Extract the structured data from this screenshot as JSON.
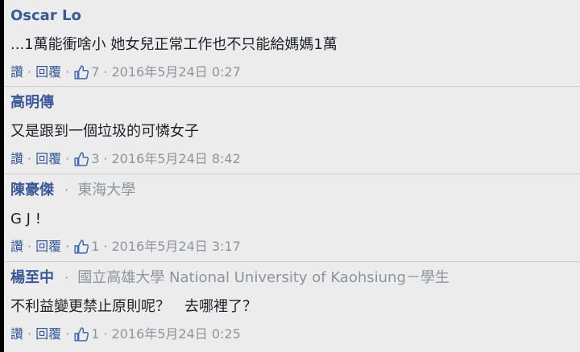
{
  "colors": {
    "author": "#3b5998",
    "link": "#365899",
    "meta": "#8d949e",
    "text": "#1d2129",
    "background": "#ececec",
    "like_icon": "#4267b2"
  },
  "labels": {
    "read": "讚",
    "reply": "回覆",
    "separator": "·",
    "like_icon": "thumbs-up-icon"
  },
  "comments": [
    {
      "author": "Oscar Lo",
      "affiliation": "",
      "text": "...1萬能衝啥小 她女兒正常工作也不只能給媽媽1萬",
      "likes": "7",
      "timestamp": "2016年5月24日 0:27"
    },
    {
      "author": "高明傳",
      "affiliation": "",
      "text": "又是跟到一個垃圾的可憐女子",
      "likes": "3",
      "timestamp": "2016年5月24日 8:42"
    },
    {
      "author": "陳豪傑",
      "affiliation": "東海大學",
      "text": "G J !",
      "likes": "1",
      "timestamp": "2016年5月24日 3:17"
    },
    {
      "author": "楊至中",
      "affiliation": "國立高雄大學 National University of Kaohsiung－學生",
      "text": "不利益變更禁止原則呢？　去哪裡了？",
      "likes": "1",
      "timestamp": "2016年5月24日 0:25"
    }
  ]
}
